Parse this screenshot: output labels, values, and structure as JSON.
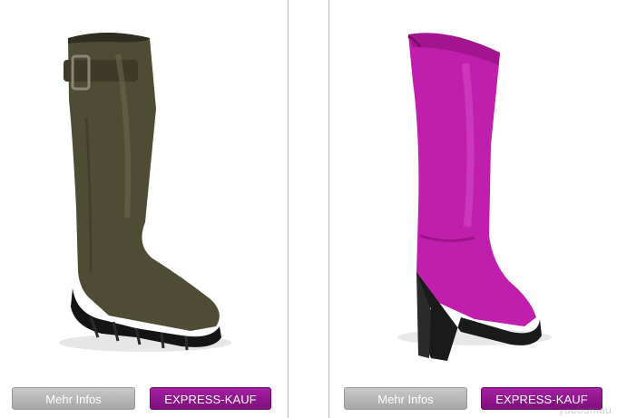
{
  "products": [
    {
      "name": "olive-leather-boot",
      "image_icon": "olive-high-boot-with-buckle",
      "color": "#4e4a35",
      "info_label": "Mehr Infos",
      "express_label": "EXPRESS-KAUF"
    },
    {
      "name": "magenta-wedge-boot",
      "image_icon": "magenta-wedge-rubber-boot",
      "color": "#c21eb0",
      "info_label": "Mehr Infos",
      "express_label": "EXPRESS-KAUF"
    }
  ],
  "watermark": "youbumau"
}
